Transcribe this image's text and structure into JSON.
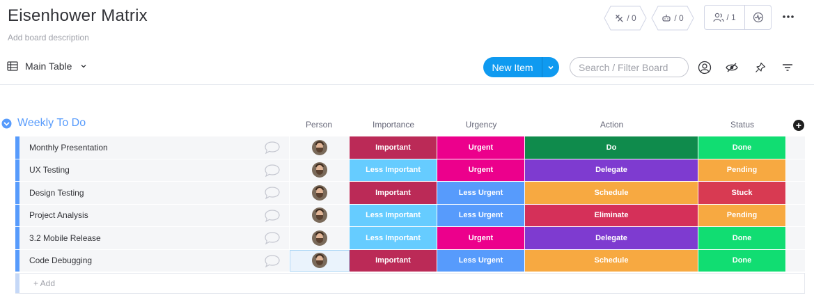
{
  "board": {
    "title": "Eisenhower Matrix",
    "description": "Add board description"
  },
  "header": {
    "integrations_count": "/ 0",
    "automations_count": "/ 0",
    "members_count": "/ 1",
    "icons": [
      "integrations-icon",
      "automations-icon",
      "members-icon",
      "activity-icon",
      "more-icon"
    ]
  },
  "toolbar": {
    "view_label": "Main Table",
    "new_item_label": "New Item",
    "search_placeholder": "Search / Filter Board",
    "accent_color": "#0f9af0"
  },
  "group": {
    "title": "Weekly To Do",
    "color": "#579bfc",
    "columns": {
      "person": "Person",
      "importance": "Importance",
      "urgency": "Urgency",
      "action": "Action",
      "status": "Status"
    },
    "add_label": "+ Add",
    "rows": [
      {
        "name": "Monthly Presentation",
        "importance": "Important",
        "urgency": "Urgent",
        "action": "Do",
        "status": "Done"
      },
      {
        "name": "UX Testing",
        "importance": "Less Important",
        "urgency": "Urgent",
        "action": "Delegate",
        "status": "Pending"
      },
      {
        "name": "Design Testing",
        "importance": "Important",
        "urgency": "Less Urgent",
        "action": "Schedule",
        "status": "Stuck"
      },
      {
        "name": "Project Analysis",
        "importance": "Less Important",
        "urgency": "Less Urgent",
        "action": "Eliminate",
        "status": "Pending"
      },
      {
        "name": "3.2 Mobile Release",
        "importance": "Less Important",
        "urgency": "Urgent",
        "action": "Delegate",
        "status": "Done"
      },
      {
        "name": "Code Debugging",
        "importance": "Important",
        "urgency": "Less Urgent",
        "action": "Schedule",
        "status": "Done"
      }
    ]
  },
  "label_colors": {
    "Important": "#bb2a57",
    "Less Important": "#66ccff",
    "Urgent": "#ec008c",
    "Less Urgent": "#579bfc",
    "Do": "#0f8b4c",
    "Delegate": "#7e3bd0",
    "Schedule": "#f7a941",
    "Eliminate": "#d53059",
    "Done": "#11dd72",
    "Pending": "#f7a941",
    "Stuck": "#d83a52"
  }
}
